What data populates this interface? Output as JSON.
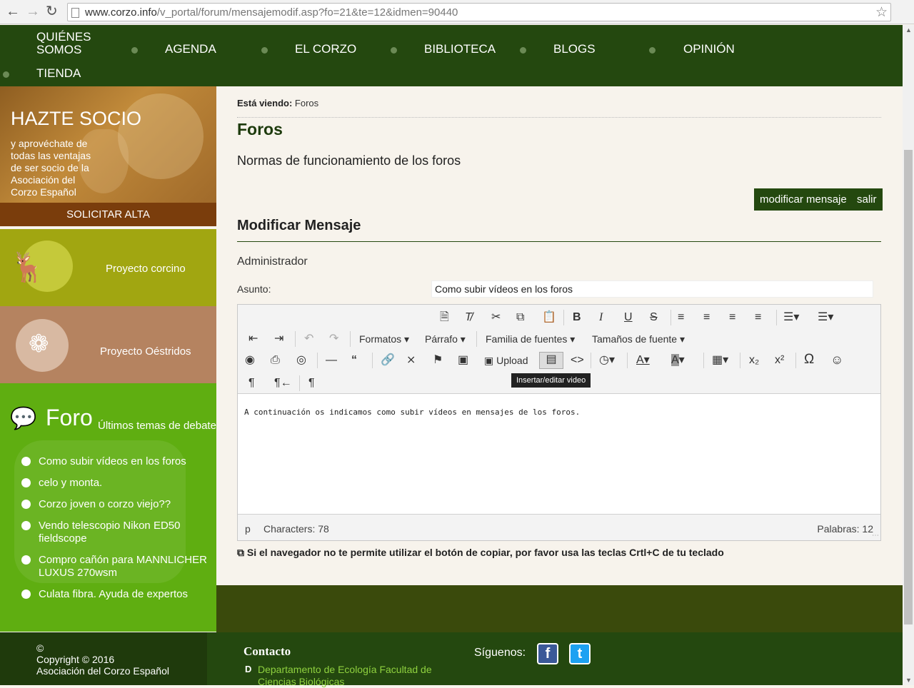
{
  "browser": {
    "url_host": "www.corzo.info",
    "url_path": "/v_portal/forum/mensajemodif.asp?fo=21&te=12&idmen=90440"
  },
  "nav": {
    "items": [
      "QUIÉNES SOMOS",
      "AGENDA",
      "EL CORZO",
      "BIBLIOTECA",
      "BLOGS",
      "OPINIÓN",
      "TIENDA"
    ]
  },
  "sidebar": {
    "socio_title": "HAZTE SOCIO",
    "socio_text": "y aprovéchate de todas las ventajas de ser socio de la Asociación del Corzo Español",
    "socio_button": "SOLICITAR ALTA",
    "proyecto1": "Proyecto corcino",
    "proyecto2": "Proyecto Oéstridos",
    "foro_title": "Foro",
    "foro_subtitle": "Últimos temas de debate",
    "topics": [
      "Como subir vídeos en los foros",
      "celo y monta.",
      "Corzo joven o corzo viejo??",
      "Vendo telescopio Nikon ED50 fieldscope",
      "Compro cañón para MANNLICHER LUXUS 270wsm",
      "Culata fibra. Ayuda de expertos"
    ]
  },
  "main": {
    "breadcrumb_label": "Está viendo:",
    "breadcrumb_value": "Foros",
    "title": "Foros",
    "normas": "Normas de funcionamiento de los foros",
    "btn_modify": "modificar mensaje",
    "btn_exit": "salir",
    "section_title": "Modificar Mensaje",
    "author": "Administrador",
    "subject_label": "Asunto:",
    "subject_value": "Como subir vídeos en los foros",
    "editor": {
      "menu_formatos": "Formatos",
      "menu_parrafo": "Párrafo",
      "menu_familia": "Familia de fuentes",
      "menu_tamanos": "Tamaños de fuente",
      "upload": "Upload",
      "tooltip": "Insertar/editar video",
      "content": "A continuación os indicamos como subir vídeos en mensajes de los foros.",
      "path": "p",
      "characters": "Characters: 78",
      "words": "Palabras: 12"
    },
    "copy_hint": "Si el navegador no te permite utilizar el botón de copiar, por favor usa las teclas Crtl+C de tu teclado"
  },
  "footer": {
    "copy_symbol": "©",
    "copyright": "Copyright © 2016",
    "org": "Asociación del Corzo Español",
    "contact_title": "Contacto",
    "contact_d": "D",
    "contact_link": "Departamento de Ecología Facultad de Ciencias Biológicas",
    "follow": "Síguenos:",
    "facebook": "f",
    "twitter": "t"
  },
  "colors": {
    "nav_green": "#24480f",
    "foro_green": "#5fae11",
    "corcino_olive": "#a1a611",
    "oestridos_brown": "#b58360",
    "alta_brown": "#7a3d0c"
  }
}
